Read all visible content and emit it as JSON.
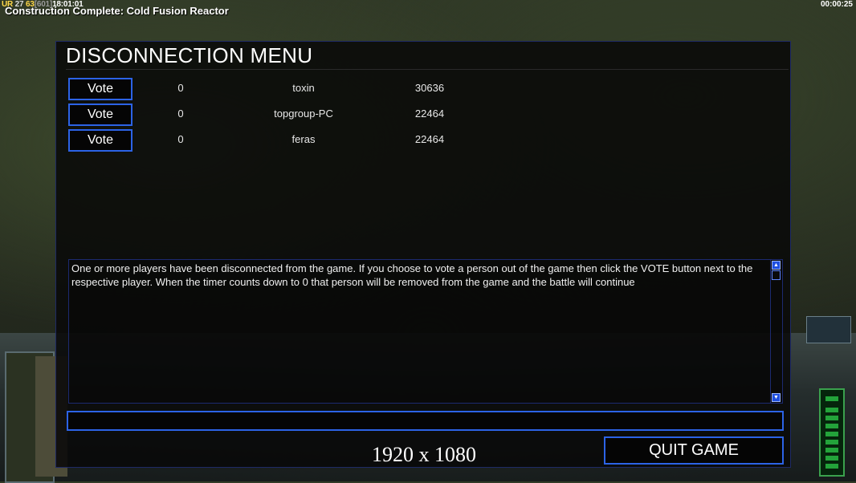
{
  "hud": {
    "ur": "UR",
    "stat_a": "27",
    "stat_b": "63",
    "stat_c": "[601]",
    "game_time": "18:01:01",
    "notification": "Construction Complete: Cold Fusion Reactor",
    "clock": "00:00:25"
  },
  "menu": {
    "title": "DISCONNECTION MENU",
    "players": [
      {
        "vote_label": "Vote",
        "votes": "0",
        "name": "toxin",
        "ping": "30636"
      },
      {
        "vote_label": "Vote",
        "votes": "0",
        "name": "topgroup-PC",
        "ping": "22464"
      },
      {
        "vote_label": "Vote",
        "votes": "0",
        "name": "feras",
        "ping": "22464"
      }
    ],
    "message": "One or more players have been disconnected from the game. If you choose to vote a person out of the game then click the VOTE button next to the respective player. When the timer counts down to 0 that person will be removed from the game and the battle will continue",
    "chat_value": "",
    "quit_label": "QUIT GAME"
  },
  "overlay": {
    "resolution": "1920 x 1080"
  }
}
